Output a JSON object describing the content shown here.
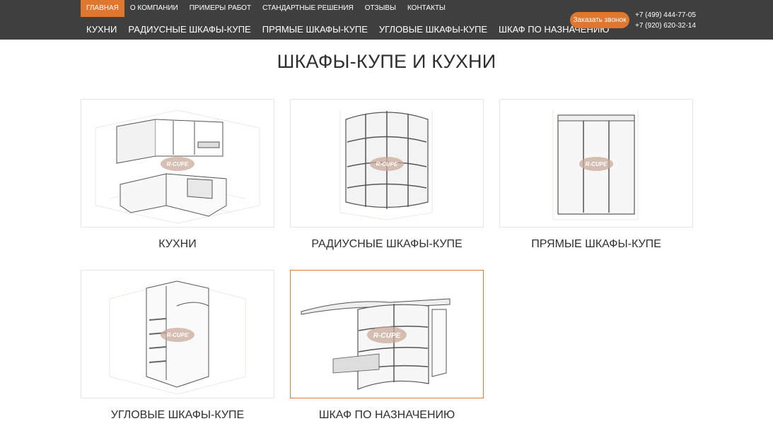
{
  "top_nav": [
    "ГЛАВНАЯ",
    "О КОМПАНИИ",
    "ПРИМЕРЫ РАБОТ",
    "СТАНДАРТНЫЕ РЕШЕНИЯ",
    "ОТЗЫВЫ",
    "КОНТАКТЫ"
  ],
  "main_nav": [
    "КУХНИ",
    "РАДИУСНЫЕ ШКАФЫ-КУПЕ",
    "ПРЯМЫЕ ШКАФЫ-КУПЕ",
    "УГЛОВЫЕ ШКАФЫ-КУПЕ",
    "ШКАФ ПО НАЗНАЧЕНИЮ"
  ],
  "call_button": "Заказать звонок",
  "phones": [
    "+7 (499) 444-77-05",
    "+7 (920) 620-32-14"
  ],
  "page_title": "ШКАФЫ-КУПЕ И КУХНИ",
  "watermark": "R-CUPE",
  "cards": [
    {
      "caption": "КУХНИ",
      "icon": "kitchen"
    },
    {
      "caption": "РАДИУСНЫЕ ШКАФЫ-КУПЕ",
      "icon": "radius-wardrobe"
    },
    {
      "caption": "ПРЯМЫЕ ШКАФЫ-КУПЕ",
      "icon": "straight-wardrobe"
    },
    {
      "caption": "УГЛОВЫЕ ШКАФЫ-КУПЕ",
      "icon": "corner-wardrobe"
    },
    {
      "caption": "ШКАФ ПО НАЗНАЧЕНИЮ",
      "icon": "custom-wardrobe"
    }
  ],
  "colors": {
    "accent": "#e0772f",
    "header_bg": "#3f3f3f",
    "text": "#2f2f2f"
  }
}
